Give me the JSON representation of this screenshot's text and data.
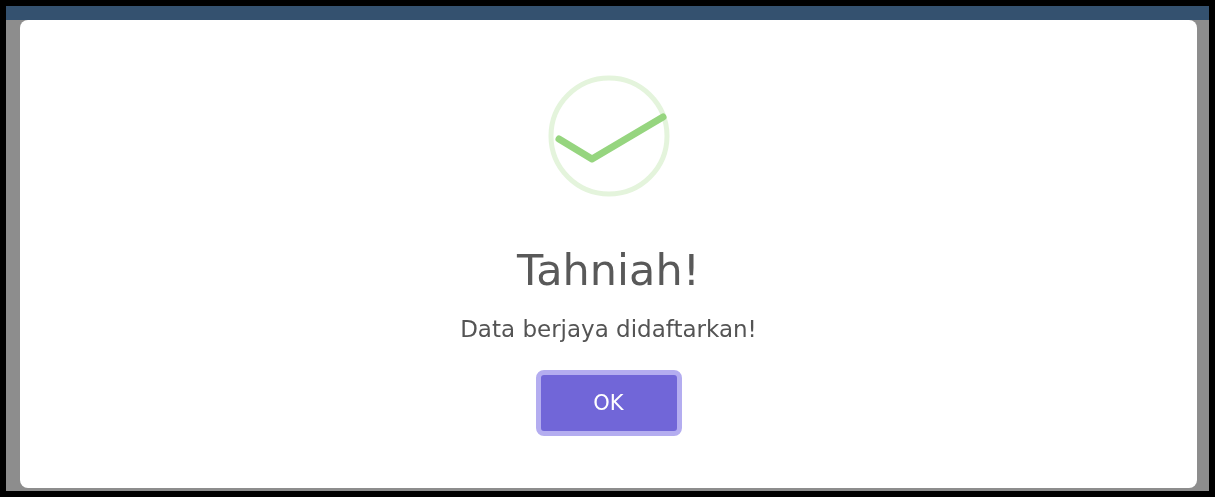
{
  "dialog": {
    "title": "Tahniah!",
    "message": "Data berjaya didaftarkan!",
    "buttons": [
      {
        "label": "OK"
      }
    ]
  }
}
